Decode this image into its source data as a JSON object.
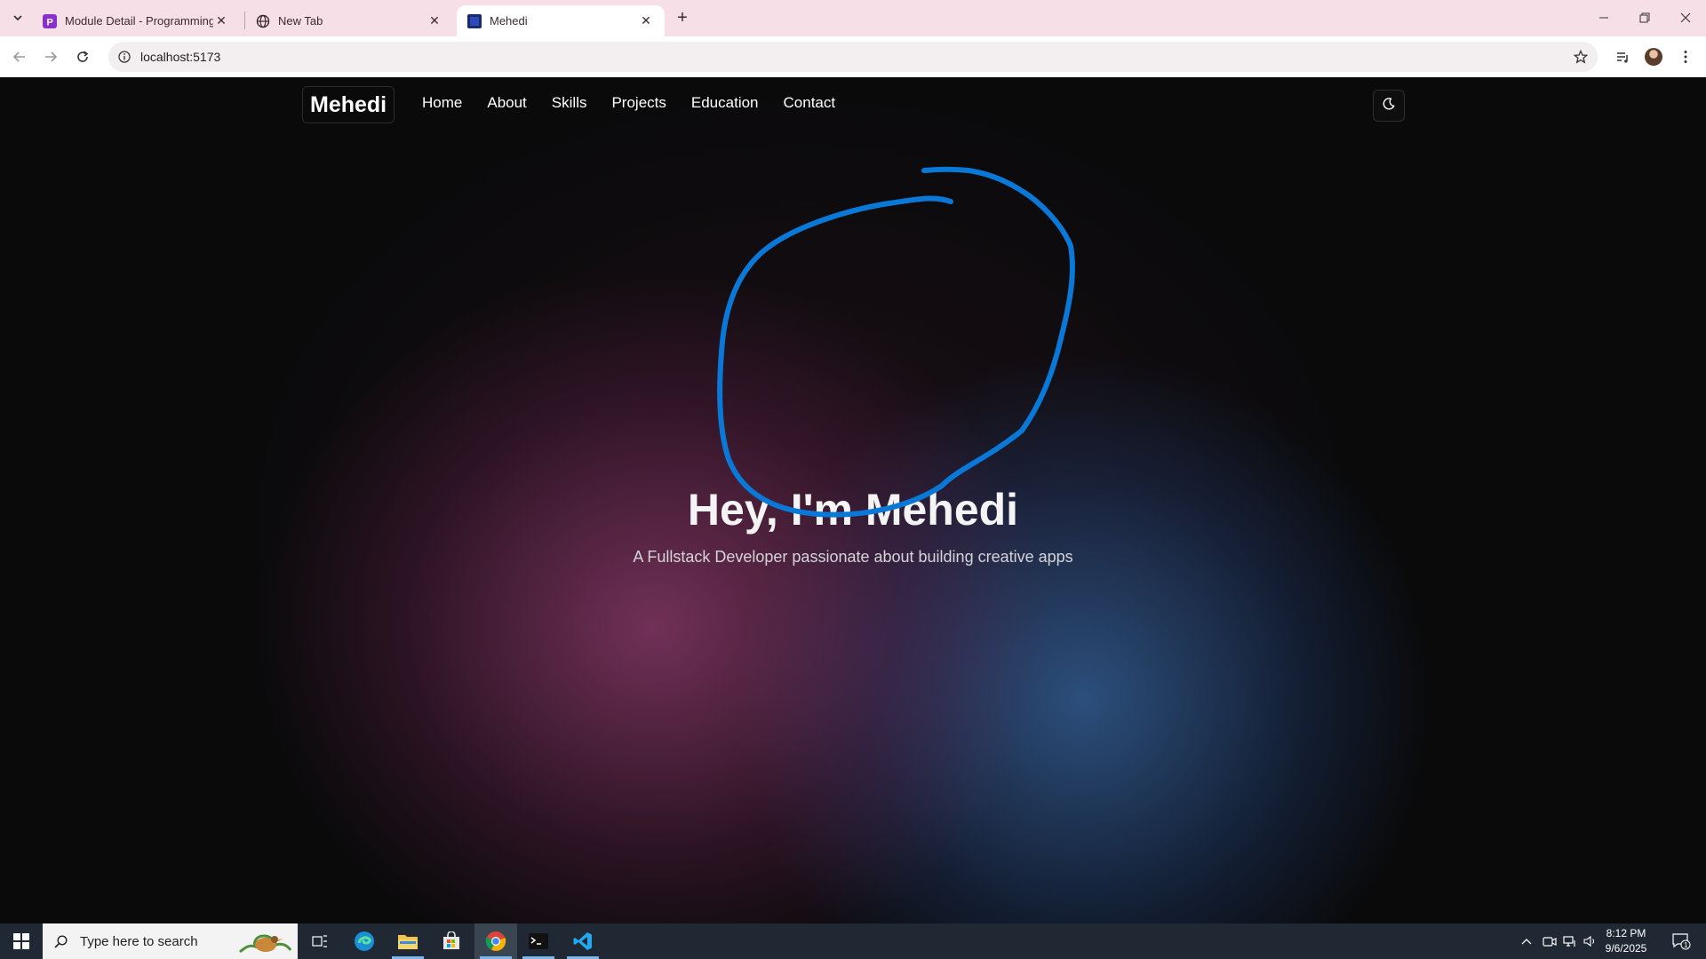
{
  "browser": {
    "tabs": [
      {
        "title": "Module Detail - Programming",
        "favicon": "p-icon",
        "active": false
      },
      {
        "title": "New Tab",
        "favicon": "globe-icon",
        "active": false
      },
      {
        "title": "Mehedi",
        "favicon": "site-icon",
        "active": true
      }
    ],
    "url": "localhost:5173"
  },
  "site": {
    "logo": "Mehedi",
    "nav": [
      "Home",
      "About",
      "Skills",
      "Projects",
      "Education",
      "Contact"
    ],
    "theme_toggle_icon": "moon-icon",
    "hero": {
      "title": "Hey, I'm Mehedi",
      "subtitle": "A Fullstack Developer passionate about building creative apps"
    }
  },
  "taskbar": {
    "search_placeholder": "Type here to search",
    "apps": [
      "task-view-icon",
      "edge-icon",
      "file-explorer-icon",
      "store-icon",
      "chrome-icon",
      "terminal-icon",
      "vscode-icon"
    ],
    "time": "8:12 PM",
    "date": "9/6/2025",
    "notification_count": "1"
  },
  "colors": {
    "tabbar": "#f6dfe6",
    "page_bg": "#0a0a0b",
    "glow_pink": "#a54682",
    "glow_blue": "#3c78be",
    "annotation": "#0a78d7",
    "taskbar": "#1f2833"
  }
}
